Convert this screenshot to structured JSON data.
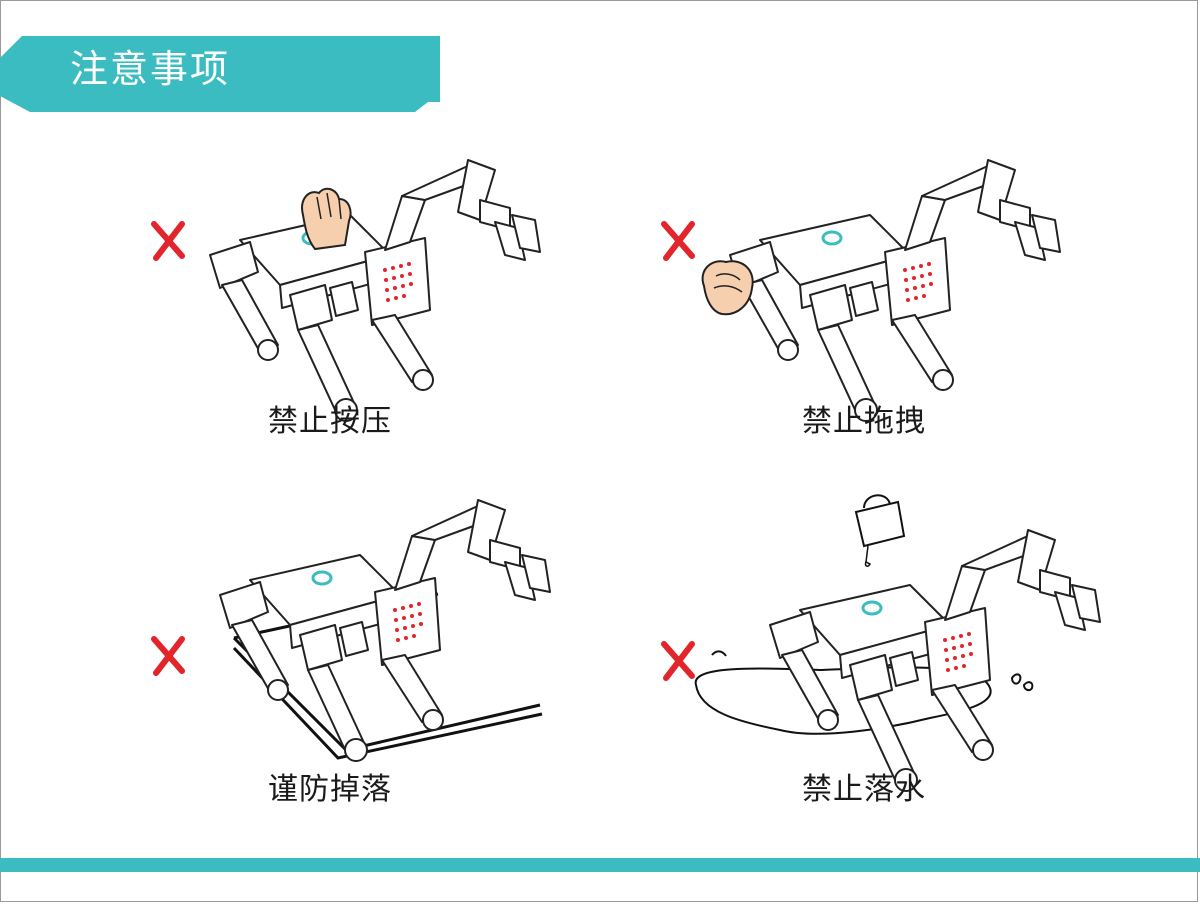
{
  "header": {
    "title": "注意事项"
  },
  "colors": {
    "accent": "#3bbcc0",
    "forbid": "#e2252b",
    "skin": "#f6cfae",
    "ink": "#222222"
  },
  "panels": [
    {
      "id": "no-press",
      "caption": "禁止按压",
      "icon": "pressing-hand-icon"
    },
    {
      "id": "no-drag",
      "caption": "禁止拖拽",
      "icon": "grabbing-hand-icon"
    },
    {
      "id": "prevent-fall",
      "caption": "谨防掉落",
      "icon": "table-edge-icon"
    },
    {
      "id": "no-water",
      "caption": "禁止落水",
      "icon": "pouring-kettle-icon"
    }
  ]
}
